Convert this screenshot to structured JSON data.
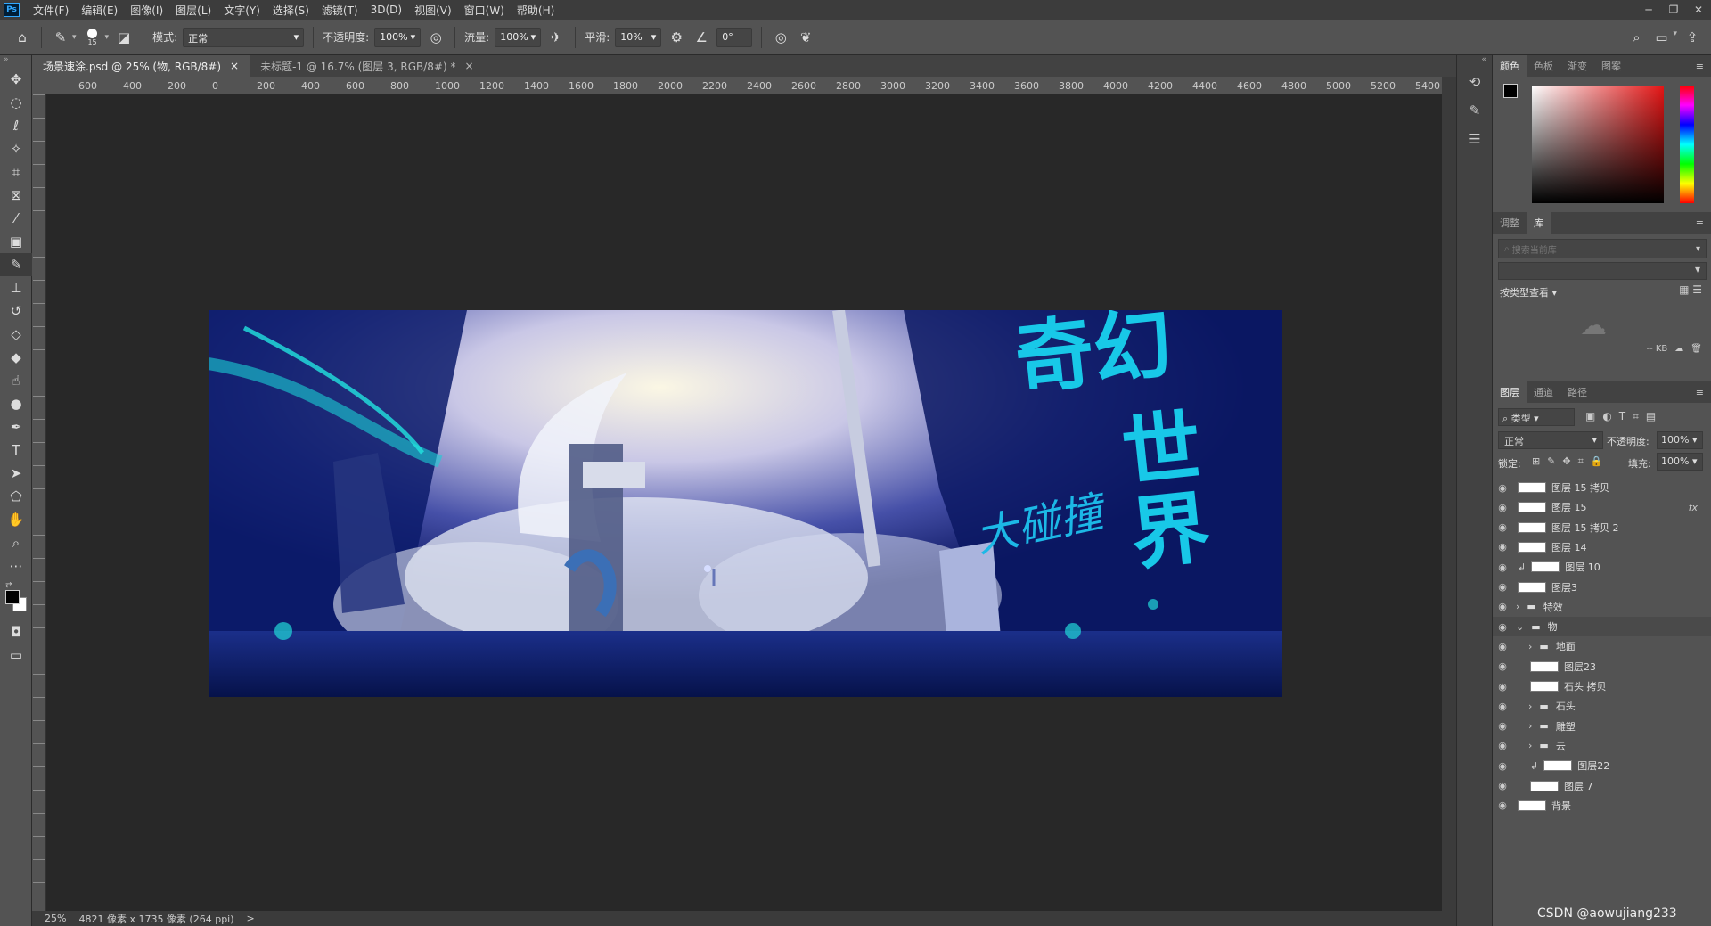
{
  "app": {
    "logo": "Ps"
  },
  "menu": [
    "文件(F)",
    "编辑(E)",
    "图像(I)",
    "图层(L)",
    "文字(Y)",
    "选择(S)",
    "滤镜(T)",
    "3D(D)",
    "视图(V)",
    "窗口(W)",
    "帮助(H)"
  ],
  "options": {
    "brush_size": "15",
    "mode_label": "模式:",
    "mode_value": "正常",
    "opacity_label": "不透明度:",
    "opacity_value": "100%",
    "flow_label": "流量:",
    "flow_value": "100%",
    "smooth_label": "平滑:",
    "smooth_value": "10%",
    "angle_value": "0°"
  },
  "tabs": [
    {
      "label": "场景速涂.psd @ 25% (物, RGB/8#)",
      "close": "×"
    },
    {
      "label": "未标题-1 @ 16.7% (图层 3, RGB/8#) *",
      "close": "×"
    }
  ],
  "ruler": {
    "h": [
      "600",
      "400",
      "200",
      "0",
      "200",
      "400",
      "600",
      "800",
      "1000",
      "1200",
      "1400",
      "1600",
      "1800",
      "2000",
      "2200",
      "2400",
      "2600",
      "2800",
      "3000",
      "3200",
      "3400",
      "3600",
      "3800",
      "4000",
      "4200",
      "4400",
      "4600",
      "4800",
      "5000",
      "5200",
      "5400"
    ]
  },
  "artwork": {
    "title_line1": "奇幻",
    "title_line2": "世界",
    "subtitle": "大碰撞"
  },
  "status": {
    "zoom": "25%",
    "doc_info": "4821 像素 x 1735 像素 (264 ppi)",
    "arrow": ">"
  },
  "color_panel": {
    "tabs": [
      "颜色",
      "色板",
      "渐变",
      "图案"
    ]
  },
  "library_panel": {
    "tabs": [
      "调整",
      "库"
    ],
    "search_placeholder": "搜索当前库",
    "view_label": "按类型查看",
    "size_label": "-- KB"
  },
  "layers_panel": {
    "tabs": [
      "图层",
      "通道",
      "路径"
    ],
    "filter_label": "类型",
    "blend_mode": "正常",
    "opacity_label": "不透明度:",
    "opacity_value": "100%",
    "lock_label": "锁定:",
    "fill_label": "填充:",
    "fill_value": "100%",
    "layers": [
      {
        "name": "图层 15 拷贝",
        "kind": "layer",
        "indent": 0
      },
      {
        "name": "图层 15",
        "kind": "layer",
        "indent": 0,
        "fx": "fx"
      },
      {
        "name": "图层 15 拷贝 2",
        "kind": "layer",
        "indent": 0
      },
      {
        "name": "图层 14",
        "kind": "layer",
        "indent": 0
      },
      {
        "name": "图层 10",
        "kind": "clip",
        "indent": 0
      },
      {
        "name": "图层3",
        "kind": "layer",
        "indent": 0
      },
      {
        "name": "特效",
        "kind": "group",
        "indent": 0
      },
      {
        "name": "物",
        "kind": "group-open",
        "indent": 0
      },
      {
        "name": "地面",
        "kind": "group",
        "indent": 1
      },
      {
        "name": "图层23",
        "kind": "layer",
        "indent": 1
      },
      {
        "name": "石头 拷贝",
        "kind": "layer",
        "indent": 1
      },
      {
        "name": "石头",
        "kind": "group",
        "indent": 1
      },
      {
        "name": "雕塑",
        "kind": "group",
        "indent": 1
      },
      {
        "name": "云",
        "kind": "group",
        "indent": 1
      },
      {
        "name": "图层22",
        "kind": "clip",
        "indent": 1
      },
      {
        "name": "图层 7",
        "kind": "layer",
        "indent": 1
      },
      {
        "name": "背景",
        "kind": "layer",
        "indent": 0
      }
    ]
  },
  "watermark": "CSDN @aowujiang233",
  "colors": {
    "fg": "#000000",
    "bg": "#ffffff",
    "accent": "#31a8ff",
    "title_cyan": "#18c8e8"
  }
}
